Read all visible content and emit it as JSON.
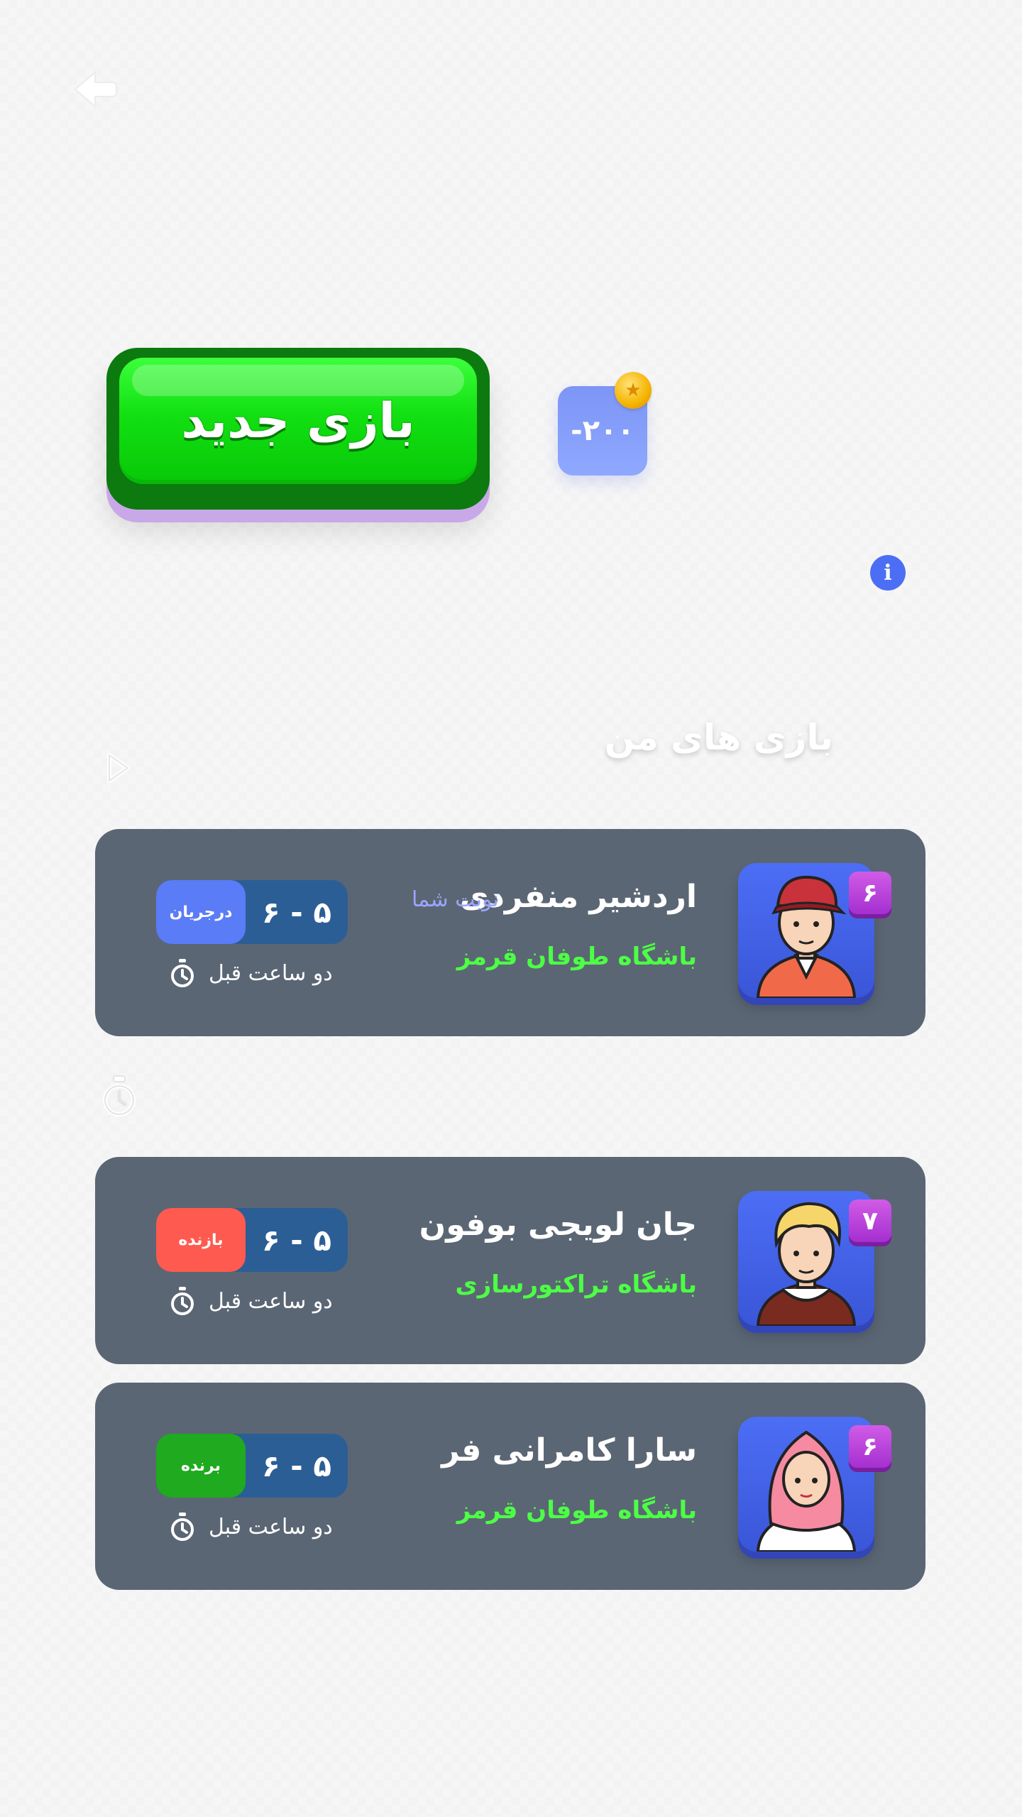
{
  "header": {
    "back_icon": "back-arrow-icon"
  },
  "new_game": {
    "label": "بازی جدید",
    "cost": "-۲۰۰",
    "coin_icon": "coin-icon",
    "info_icon": "info-icon"
  },
  "section": {
    "title": "بازی های من"
  },
  "games": [
    {
      "name": "اردشیر منفردی",
      "club": "باشگاه طوفان قرمز",
      "turn": "نوبت شما",
      "level": "۶",
      "score": "۵ - ۶",
      "status": "درجریان",
      "status_color": "#5b7cf7",
      "time": "دو ساعت قبل",
      "avatar": "male-cap-avatar"
    },
    {
      "name": "جان لویجی بوفون",
      "club": "باشگاه تراکتورسازی",
      "turn": "",
      "level": "۷",
      "score": "۵ - ۶",
      "status": "بازنده",
      "status_color": "#ff5a4f",
      "time": "دو ساعت قبل",
      "avatar": "blond-male-avatar"
    },
    {
      "name": "سارا کامرانی فر",
      "club": "باشگاه طوفان قرمز",
      "turn": "",
      "level": "۶",
      "score": "۵ - ۶",
      "status": "برنده",
      "status_color": "#1faa1f",
      "time": "دو ساعت قبل",
      "avatar": "hijab-female-avatar"
    }
  ],
  "colors": {
    "card_bg": "#5b6674",
    "club_green": "#4dff45",
    "accent_blue": "#4c6ef5",
    "score_box": "#2c5e96"
  }
}
